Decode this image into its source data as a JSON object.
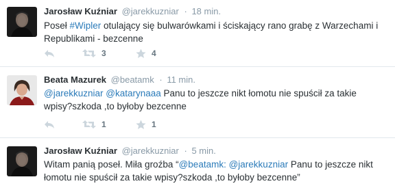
{
  "tweets": [
    {
      "name": "Jarosław Kuźniar",
      "handle": "@jarekkuzniar",
      "time": "18 min.",
      "text_parts": [
        {
          "t": "Poseł ",
          "link": false
        },
        {
          "t": "#Wipler",
          "link": true
        },
        {
          "t": " otulający się bulwarówkami i ściskający rano grabę z Warzechami i Republikami - bezcenne",
          "link": false
        }
      ],
      "retweets": "3",
      "favorites": "4",
      "avatar": "man-dark-portrait"
    },
    {
      "name": "Beata Mazurek",
      "handle": "@beatamk",
      "time": "11 min.",
      "text_parts": [
        {
          "t": "@jarekkuzniar",
          "link": true
        },
        {
          "t": " ",
          "link": false
        },
        {
          "t": "@katarynaaa",
          "link": true
        },
        {
          "t": " Panu to jeszcze nikt łomotu nie spuścił za takie wpisy?szkoda ,to byłoby bezcenne",
          "link": false
        }
      ],
      "retweets": "1",
      "favorites": "1",
      "avatar": "woman-portrait"
    },
    {
      "name": "Jarosław Kuźniar",
      "handle": "@jarekkuzniar",
      "time": "5 min.",
      "text_parts": [
        {
          "t": "Witam panią poseł. Miła groźba “",
          "link": false
        },
        {
          "t": "@beatamk",
          "link": true
        },
        {
          "t": ": ",
          "link": false
        },
        {
          "t": "@jarekkuzniar",
          "link": true
        },
        {
          "t": " Panu to jeszcze nikt łomotu nie spuścił za takie wpisy?szkoda ,to byłoby bezcenne”",
          "link": false
        }
      ],
      "avatar": "man-dark-portrait"
    }
  ],
  "icons": {
    "reply": "reply-icon",
    "retweet": "retweet-icon",
    "favorite": "star-icon"
  },
  "colors": {
    "link": "#2b7bb9",
    "meta": "#8899a6",
    "icon": "#ccd6dd",
    "divider": "#e1e8ed"
  }
}
